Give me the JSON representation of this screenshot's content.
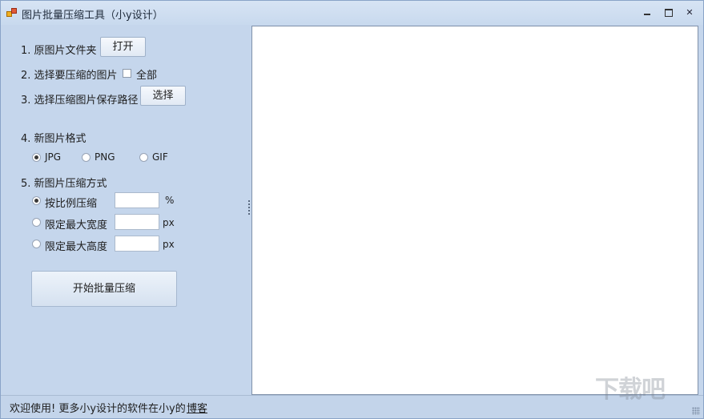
{
  "window": {
    "title": "图片批量压缩工具（小y设计）",
    "controls": {
      "minimize": "minimize",
      "maximize": "maximize",
      "close": "✕"
    }
  },
  "steps": {
    "step1_label": "1. 原图片文件夹",
    "open_button": "打开",
    "step2_label": "2. 选择要压缩的图片",
    "select_all_label": "全部",
    "select_all_checked": false,
    "step3_label": "3. 选择压缩图片保存路径",
    "choose_button": "选择",
    "step4_label": "4. 新图片格式",
    "formats": [
      {
        "label": "JPG",
        "selected": true
      },
      {
        "label": "PNG",
        "selected": false
      },
      {
        "label": "GIF",
        "selected": false
      }
    ],
    "step5_label": "5. 新图片压缩方式",
    "methods": [
      {
        "label": "按比例压缩",
        "selected": true,
        "value": "",
        "unit": "%"
      },
      {
        "label": "限定最大宽度",
        "selected": false,
        "value": "",
        "unit": "px"
      },
      {
        "label": "限定最大高度",
        "selected": false,
        "value": "",
        "unit": "px"
      }
    ],
    "start_button": "开始批量压缩"
  },
  "status": {
    "text": "欢迎使用! 更多小y设计的软件在小y的",
    "link": "博客"
  },
  "watermark": "下载吧"
}
